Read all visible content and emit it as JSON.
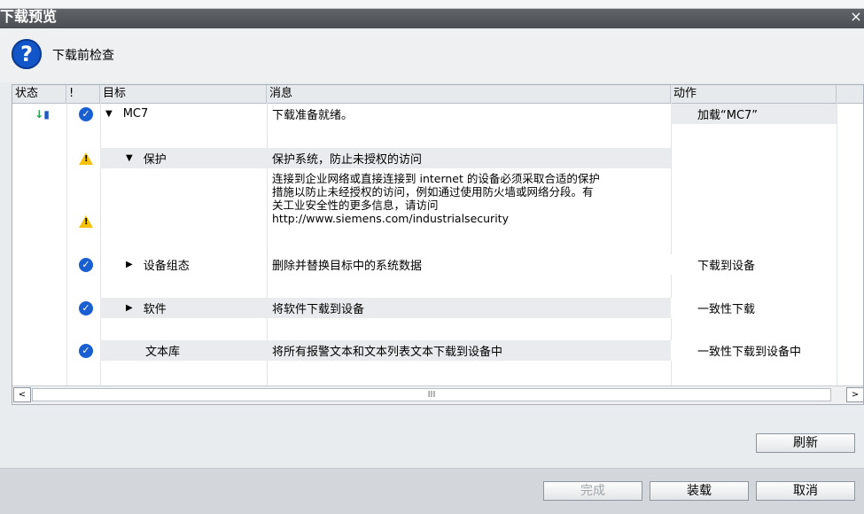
{
  "window": {
    "title": "下载预览",
    "close": "×"
  },
  "heading": "下载前检查",
  "columns": [
    "状态",
    "!",
    "目标",
    "消息",
    "动作"
  ],
  "rows": [
    {
      "target": "MC7",
      "message": "下载准备就绪。",
      "action": "加载“MC7”"
    },
    {
      "target": "保护",
      "message": "保护系统，防止未授权的访问"
    },
    {
      "message_lines": [
        "连接到企业网络或直接连接到 internet 的设备必须采取合适的保护",
        "措施以防止未经授权的访问，例如通过使用防火墙或网络分段。有",
        "关工业安全性的更多信息，请访问",
        "http://www.siemens.com/industrialsecurity"
      ]
    },
    {
      "target": "设备组态",
      "message": "删除并替换目标中的系统数据",
      "action": "下载到设备"
    },
    {
      "target": "软件",
      "message": "将软件下载到设备",
      "action": "一致性下载"
    },
    {
      "target": "文本库",
      "message": "将所有报警文本和文本列表文本下载到设备中",
      "action": "一致性下载到设备中"
    }
  ],
  "scrollbar": {
    "left": "<",
    "right": ">",
    "thumb": "III"
  },
  "buttons": {
    "refresh": "刷新",
    "finish": "完成",
    "load": "装载",
    "cancel": "取消"
  },
  "icons": {
    "question": "question-circle-icon",
    "ok": "check-circle-icon",
    "warn": "warning-triangle-icon"
  }
}
